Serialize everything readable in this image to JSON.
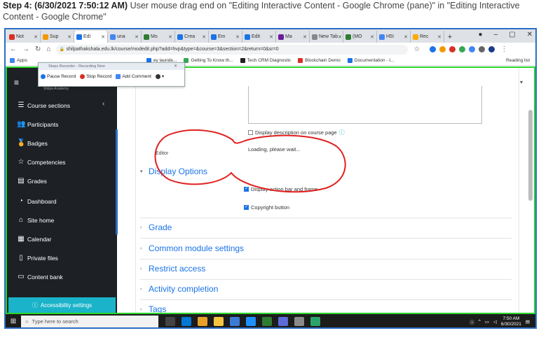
{
  "caption": {
    "step": "Step 4: (6/30/2021 7:50:12 AM)",
    "text": " User mouse drag end on \"Editing Interactive Content - Google Chrome (pane)\" in \"Editing Interactive Content - Google Chrome\""
  },
  "browser": {
    "tabs": [
      {
        "label": "Not",
        "color": "#d93025"
      },
      {
        "label": "Sup",
        "color": "#f29900"
      },
      {
        "label": "Edi",
        "color": "#1a73e8",
        "active": true
      },
      {
        "label": "una",
        "color": "#4285f4"
      },
      {
        "label": "Mo",
        "color": "#2e7d32"
      },
      {
        "label": "Crea",
        "color": "#1a73e8"
      },
      {
        "label": "Em",
        "color": "#1a73e8"
      },
      {
        "label": "Edit",
        "color": "#1a73e8"
      },
      {
        "label": "Ma",
        "color": "#6a1b9a"
      },
      {
        "label": "New Tab",
        "color": "#888888"
      },
      {
        "label": "(MO",
        "color": "#2e7d32"
      },
      {
        "label": "H5I",
        "color": "#4285f4"
      },
      {
        "label": "Rec",
        "color": "#f9ab00"
      }
    ],
    "new_tab": "+",
    "url": "shilpathakshala.edu.lk/course/modedit.php?add=hvp&type=&course=3&section=2&return=0&sr=0",
    "bookmarks": [
      {
        "label": "Apps",
        "color": "#4285f4"
      },
      {
        "label": "ey launde...",
        "color": "#1a73e8"
      },
      {
        "label": "Getting To Know th...",
        "color": "#34a853"
      },
      {
        "label": "Tech CRM Diagnostic",
        "color": "#222222"
      },
      {
        "label": "Blockchain Demo",
        "color": "#d93025"
      },
      {
        "label": "Documentation - I...",
        "color": "#1a73e8"
      }
    ],
    "reading_list": "Reading list"
  },
  "recorder": {
    "title": "Steps Recorder - Recording Now",
    "pause": "Pause Record",
    "stop": "Stop Record",
    "add_comment": "Add Comment"
  },
  "moodle": {
    "logo_text": "Shilpa Academy",
    "nav": [
      {
        "label": "Course sections",
        "icon": "list-icon",
        "glyph": "☰"
      },
      {
        "label": "Participants",
        "icon": "participants-icon",
        "glyph": "👥"
      },
      {
        "label": "Badges",
        "icon": "badge-icon",
        "glyph": "🏅"
      },
      {
        "label": "Competencies",
        "icon": "competency-icon",
        "glyph": "☆"
      },
      {
        "label": "Grades",
        "icon": "grades-icon",
        "glyph": "▤"
      },
      {
        "label": "Dashboard",
        "icon": "dashboard-icon",
        "glyph": "◔"
      },
      {
        "label": "Site home",
        "icon": "home-icon",
        "glyph": "⌂"
      },
      {
        "label": "Calendar",
        "icon": "calendar-icon",
        "glyph": "▦"
      },
      {
        "label": "Private files",
        "icon": "files-icon",
        "glyph": "▯"
      },
      {
        "label": "Content bank",
        "icon": "content-bank-icon",
        "glyph": "▭"
      }
    ],
    "accessibility": "Accessibility settings",
    "form": {
      "display_description": "Display description on course page",
      "editor_label": "Editor",
      "loading": "Loading, please wait...",
      "display_options": "Display Options",
      "action_bar": "Display action bar and frame",
      "copyright": "Copyright button",
      "sections": [
        "Grade",
        "Common module settings",
        "Restrict access",
        "Activity completion",
        "Tags"
      ]
    }
  },
  "taskbar": {
    "search_placeholder": "Type here to search",
    "time": "7:50 AM",
    "date": "6/30/2021"
  },
  "colors": {
    "accent": "#1a73e8",
    "sidebar": "#1d2125",
    "highlight_border": "#2bd52b",
    "annotation": "#e02020"
  }
}
